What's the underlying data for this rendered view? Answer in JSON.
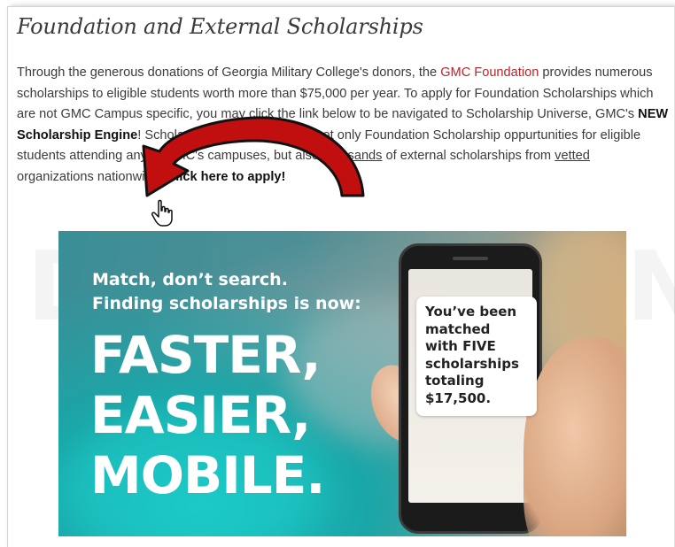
{
  "title": "Foundation and External Scholarships",
  "paragraph": {
    "p1": "Through the generous donations of Georgia Military College's donors, the ",
    "link_gmc_foundation": "GMC Foundation",
    "p2": " provides numerous scholarships to eligible students worth more than $75,000 per year. To apply for Foundation Scholarships which are not GMC Campus specific, you may click the link below to be navigated to Scholarship Universe, GMC's ",
    "bold_engine": "NEW Scholarship Engine",
    "p3": "! Scholarship Universe houses not only Foundation Scholarship oppurtunities for eligible students attending any of GMC's campuses, but also ",
    "u_thousands": "thousands",
    "p4": " of external scholarships from ",
    "u_vetted": "vetted",
    "p5": " organizations nationwide! ",
    "apply_link": "Click here to apply!"
  },
  "banner": {
    "tagline_line1": "Match, don’t search.",
    "tagline_line2": "Finding scholarships is now:",
    "word1": "FASTER,",
    "word2": "EASIER,",
    "word3": "MOBILE.",
    "phone_message_l1": "You’ve been",
    "phone_message_l2": "matched",
    "phone_message_l3": "with FIVE",
    "phone_message_l4": "scholarships",
    "phone_message_l5": "totaling",
    "phone_message_l6": "$17,500."
  },
  "watermark": "DEVENSIAN",
  "colors": {
    "link": "#b6262d",
    "arrow_fill": "#c10f0f",
    "arrow_outline": "#111111",
    "banner_teal": "#1aa6a8"
  },
  "icons": {
    "arrow": "curved-arrow-icon",
    "cursor": "hand-pointer-icon"
  }
}
